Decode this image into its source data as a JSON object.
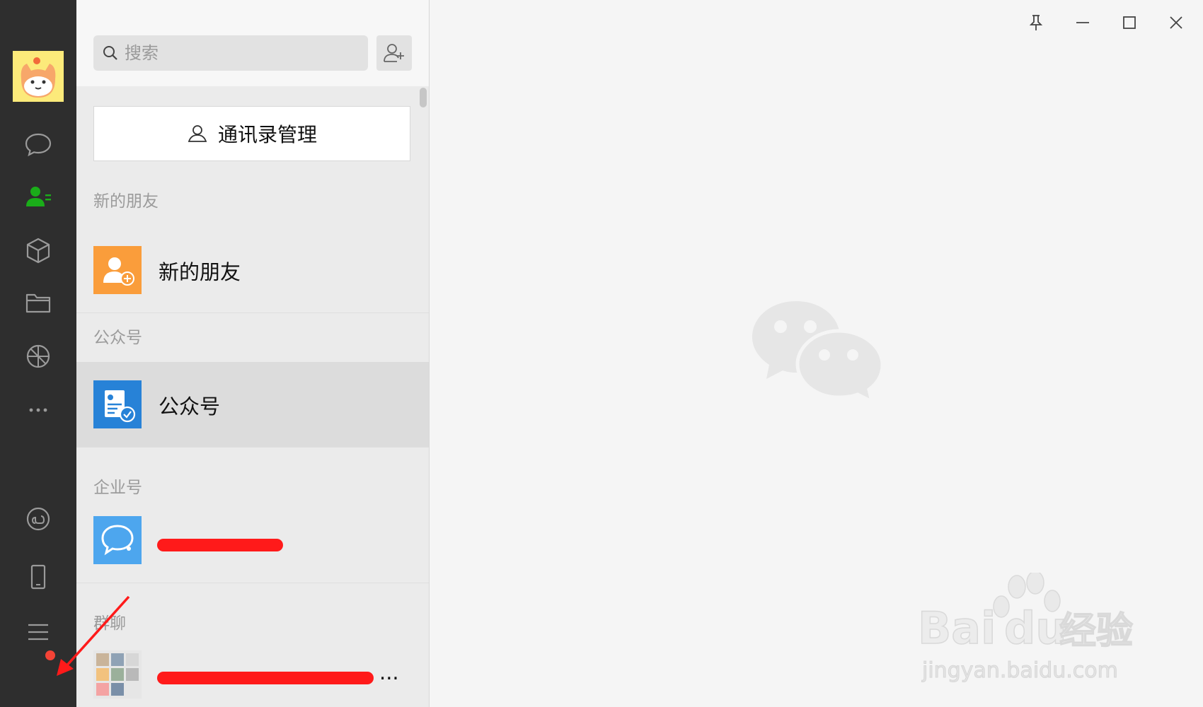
{
  "nav": {
    "icons": [
      "chat-icon",
      "contacts-icon",
      "box-icon",
      "folder-icon",
      "moments-icon",
      "more-icon",
      "mini-program-icon",
      "phone-icon",
      "menu-icon"
    ]
  },
  "search": {
    "placeholder": "搜索"
  },
  "contacts": {
    "manage_label": "通讯录管理",
    "sections": [
      {
        "title": "新的朋友",
        "item": "新的朋友"
      },
      {
        "title": "公众号",
        "item": "公众号"
      },
      {
        "title": "企业号",
        "item": ""
      },
      {
        "title": "群聊",
        "item": "..."
      }
    ]
  },
  "colors": {
    "accent": "#1aad19",
    "nav_bg": "#2e2e2e",
    "redact": "#ff1a1a"
  },
  "watermark": {
    "brand": "Baidu经验",
    "url": "jingyan.baidu.com"
  }
}
